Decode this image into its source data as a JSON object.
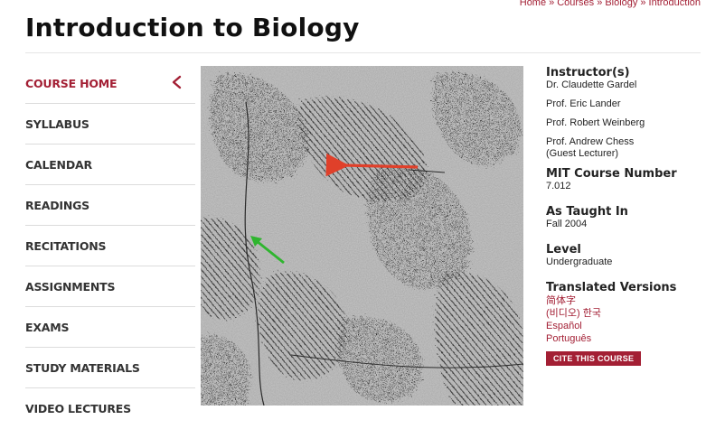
{
  "breadcrumb": {
    "items": [
      "Home",
      "Courses",
      "Biology",
      "Introduction"
    ],
    "separator": "»"
  },
  "page": {
    "title": "Introduction to Biology"
  },
  "sidebar": {
    "items": [
      {
        "label": "COURSE HOME",
        "active": true
      },
      {
        "label": "SYLLABUS"
      },
      {
        "label": "CALENDAR"
      },
      {
        "label": "READINGS"
      },
      {
        "label": "RECITATIONS"
      },
      {
        "label": "ASSIGNMENTS"
      },
      {
        "label": "EXAMS"
      },
      {
        "label": "STUDY MATERIALS"
      },
      {
        "label": "VIDEO LECTURES"
      }
    ],
    "collapse_icon": "chevron-left-icon"
  },
  "course_info": {
    "instructors_label": "Instructor(s)",
    "instructors": [
      {
        "name": "Dr. Claudette Gardel"
      },
      {
        "name": "Prof. Eric Lander"
      },
      {
        "name": "Prof. Robert Weinberg"
      },
      {
        "name": "Prof. Andrew Chess",
        "note": "(Guest Lecturer)"
      }
    ],
    "course_number_label": "MIT Course Number",
    "course_number": "7.012",
    "taught_in_label": "As Taught In",
    "taught_in": "Fall 2004",
    "level_label": "Level",
    "level": "Undergraduate",
    "translated_label": "Translated Versions",
    "translations": [
      "简体字",
      "(비디오) 한국",
      "Español",
      "Português"
    ],
    "cite_button": "CITE THIS COURSE"
  },
  "colors": {
    "accent": "#a31f34",
    "arrow_red": "#e0402a",
    "arrow_green": "#2fb52f"
  }
}
